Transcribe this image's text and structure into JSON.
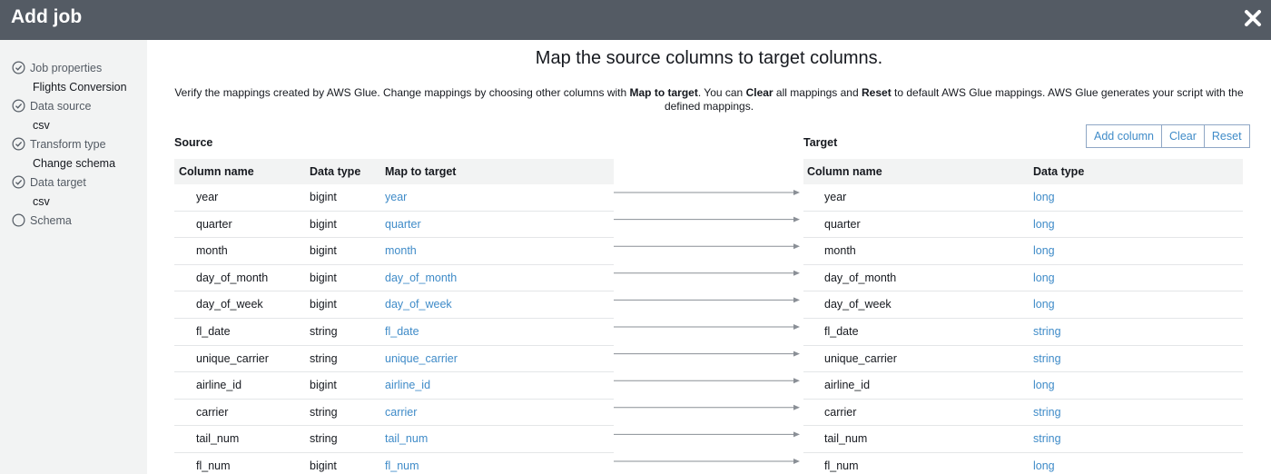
{
  "window": {
    "title": "Add job"
  },
  "sidebar": {
    "steps": [
      {
        "label": "Job properties",
        "sub": "Flights Conversion",
        "status": "done"
      },
      {
        "label": "Data source",
        "sub": "csv",
        "status": "done"
      },
      {
        "label": "Transform type",
        "sub": "Change schema",
        "status": "done"
      },
      {
        "label": "Data target",
        "sub": "csv",
        "status": "done"
      },
      {
        "label": "Schema",
        "sub": "",
        "status": "current"
      }
    ]
  },
  "main": {
    "heading": "Map the source columns to target columns.",
    "description": {
      "p1": "Verify the mappings created by AWS Glue. Change mappings by choosing other columns with ",
      "b1": "Map to target",
      "p2": ". You can ",
      "b2": "Clear",
      "p3": " all mappings and ",
      "b3": "Reset",
      "p4": " to default AWS Glue mappings. AWS Glue generates your script with the defined mappings."
    },
    "source_label": "Source",
    "target_label": "Target",
    "buttons": {
      "add_column": "Add column",
      "clear": "Clear",
      "reset": "Reset"
    },
    "source_headers": {
      "column_name": "Column name",
      "data_type": "Data type",
      "map_to_target": "Map to target"
    },
    "target_headers": {
      "column_name": "Column name",
      "data_type": "Data type"
    },
    "rows": [
      {
        "src_name": "year",
        "src_type": "bigint",
        "map": "year",
        "tgt_name": "year",
        "tgt_type": "long"
      },
      {
        "src_name": "quarter",
        "src_type": "bigint",
        "map": "quarter",
        "tgt_name": "quarter",
        "tgt_type": "long"
      },
      {
        "src_name": "month",
        "src_type": "bigint",
        "map": "month",
        "tgt_name": "month",
        "tgt_type": "long"
      },
      {
        "src_name": "day_of_month",
        "src_type": "bigint",
        "map": "day_of_month",
        "tgt_name": "day_of_month",
        "tgt_type": "long"
      },
      {
        "src_name": "day_of_week",
        "src_type": "bigint",
        "map": "day_of_week",
        "tgt_name": "day_of_week",
        "tgt_type": "long"
      },
      {
        "src_name": "fl_date",
        "src_type": "string",
        "map": "fl_date",
        "tgt_name": "fl_date",
        "tgt_type": "string"
      },
      {
        "src_name": "unique_carrier",
        "src_type": "string",
        "map": "unique_carrier",
        "tgt_name": "unique_carrier",
        "tgt_type": "string"
      },
      {
        "src_name": "airline_id",
        "src_type": "bigint",
        "map": "airline_id",
        "tgt_name": "airline_id",
        "tgt_type": "long"
      },
      {
        "src_name": "carrier",
        "src_type": "string",
        "map": "carrier",
        "tgt_name": "carrier",
        "tgt_type": "string"
      },
      {
        "src_name": "tail_num",
        "src_type": "string",
        "map": "tail_num",
        "tgt_name": "tail_num",
        "tgt_type": "string"
      },
      {
        "src_name": "fl_num",
        "src_type": "bigint",
        "map": "fl_num",
        "tgt_name": "fl_num",
        "tgt_type": "long"
      }
    ]
  },
  "colors": {
    "titlebar": "#545b64",
    "sidebar": "#f2f3f3",
    "link": "#3f8bc8",
    "text": "#16191f"
  },
  "icons": {
    "close": "close-icon",
    "step_done": "check-circle-icon",
    "step_current": "empty-circle-icon",
    "mapping": "arrow-right-icon"
  }
}
